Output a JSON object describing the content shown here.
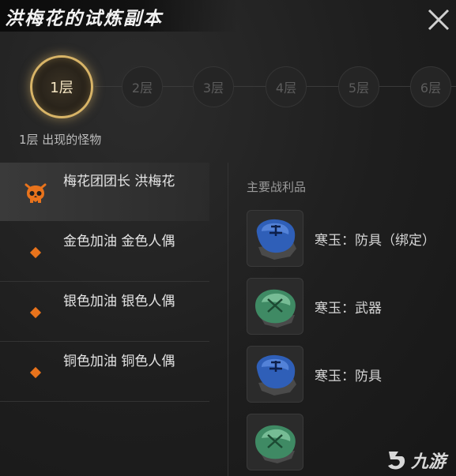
{
  "title": "洪梅花的试炼副本",
  "floors": [
    {
      "label": "1层",
      "active": true
    },
    {
      "label": "2层",
      "active": false
    },
    {
      "label": "3层",
      "active": false
    },
    {
      "label": "4层",
      "active": false
    },
    {
      "label": "5层",
      "active": false
    },
    {
      "label": "6层",
      "active": false
    }
  ],
  "floor_subtitle": "1层 出现的怪物",
  "monsters": [
    {
      "name": "梅花团团长 洪梅花",
      "icon": "boss-skull-icon",
      "selected": true
    },
    {
      "name": "金色加油 金色人偶",
      "icon": "diamond-icon",
      "selected": false
    },
    {
      "name": "银色加油 银色人偶",
      "icon": "diamond-icon",
      "selected": false
    },
    {
      "name": "铜色加油 铜色人偶",
      "icon": "diamond-icon",
      "selected": false
    }
  ],
  "loot_header": "主要战利品",
  "loot": [
    {
      "label": "寒玉：防具（绑定）",
      "gem": "blue"
    },
    {
      "label": "寒玉：武器",
      "gem": "green"
    },
    {
      "label": "寒玉：防具",
      "gem": "blue"
    },
    {
      "label": "",
      "gem": "green"
    }
  ],
  "watermark": "九游",
  "colors": {
    "accent_gold": "#d8b467",
    "accent_orange": "#e8731c",
    "gem_blue": "#2f5fb8",
    "gem_green": "#3f8a64"
  }
}
